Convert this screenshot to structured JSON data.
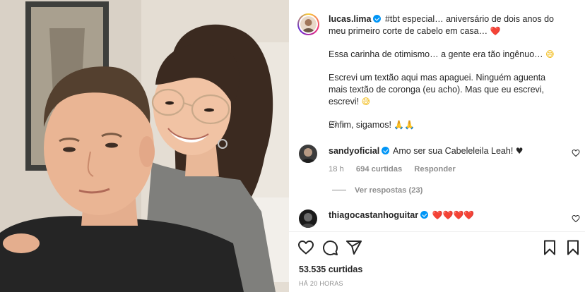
{
  "photo": {
    "description_icon": "photo-of-two-people"
  },
  "post": {
    "author": "lucas.lima",
    "caption_first": "#tbt especial… aniversário de dois anos do meu primeiro corte de cabelo em casa…",
    "caption_first_emoji": "❤️",
    "caption_p2": "Essa carinha de otimismo… a gente era tão ingênuo…",
    "caption_p2_emoji": "😅",
    "caption_p3": "Escrevi um textão aqui mas apaguei. Ninguém aguenta mais textão de coronga (eu acho). Mas que eu escrevi, escrevi!",
    "caption_p3_emoji": "😅",
    "caption_p4": "Enfim, sigamos!",
    "caption_p4_emoji": "🙏🙏",
    "time": "20 h"
  },
  "comments": [
    {
      "user": "sandyoficial",
      "text": "Amo ser sua Cabeleleila Leah!",
      "emoji": "♥",
      "time": "18 h",
      "likes": "694 curtidas",
      "reply_label": "Responder",
      "view_replies": "Ver respostas (23)"
    },
    {
      "user": "thiagocastanhoguitar",
      "text": "❤️❤️❤️❤️"
    }
  ],
  "footer": {
    "likes": "53.535 curtidas",
    "date": "HÁ 20 HORAS"
  },
  "colors": {
    "verified": "#0095f6",
    "muted": "#8e8e8e",
    "text": "#262626",
    "heart": "#ed2b3b"
  },
  "icons": [
    "heart-icon",
    "comment-icon",
    "share-icon",
    "bookmark-icon",
    "verified-badge-icon"
  ]
}
